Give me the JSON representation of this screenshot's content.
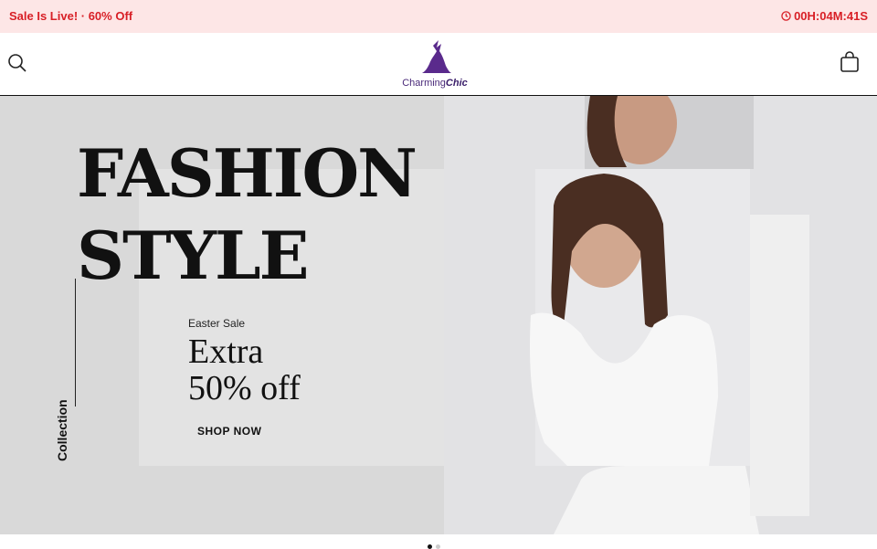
{
  "announcement": {
    "left": "Sale Is Live! · 60% Off",
    "timer": "00H:04M:41S"
  },
  "header": {
    "logo": {
      "part1": "Charming",
      "part2": "Chic"
    }
  },
  "hero": {
    "title_line1": "FASHION",
    "title_line2": "STYLE",
    "vertical_label": "Collection",
    "promo_label": "Easter Sale",
    "promo_line1": "Extra",
    "promo_line2": "50% off",
    "cta": "SHOP NOW"
  },
  "colors": {
    "accent": "#d81f26",
    "logo": "#5a2a8c"
  },
  "slider": {
    "current": 1,
    "total": 2
  }
}
